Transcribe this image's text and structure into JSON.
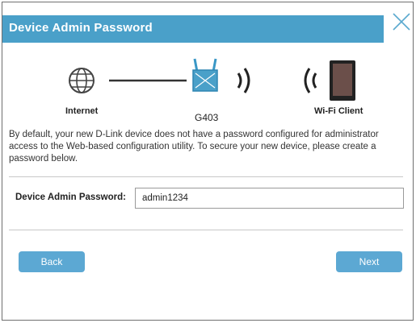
{
  "dialog": {
    "title": "Device Admin Password",
    "close_icon": "close-icon"
  },
  "diagram": {
    "internet_label": "Internet",
    "router_label": "G403",
    "client_label": "Wi-Fi Client",
    "icons": [
      "globe-icon",
      "router-icon",
      "wifi-signal-icon",
      "tablet-icon"
    ]
  },
  "description": "By default, your new D-Link device does not have a password configured for administrator access to the Web-based configuration utility. To secure your new device, please create a password below.",
  "form": {
    "label": "Device Admin Password:",
    "value": "admin1234"
  },
  "buttons": {
    "back": "Back",
    "next": "Next"
  },
  "colors": {
    "accent": "#4aa0c9",
    "button": "#5ca8d3"
  }
}
